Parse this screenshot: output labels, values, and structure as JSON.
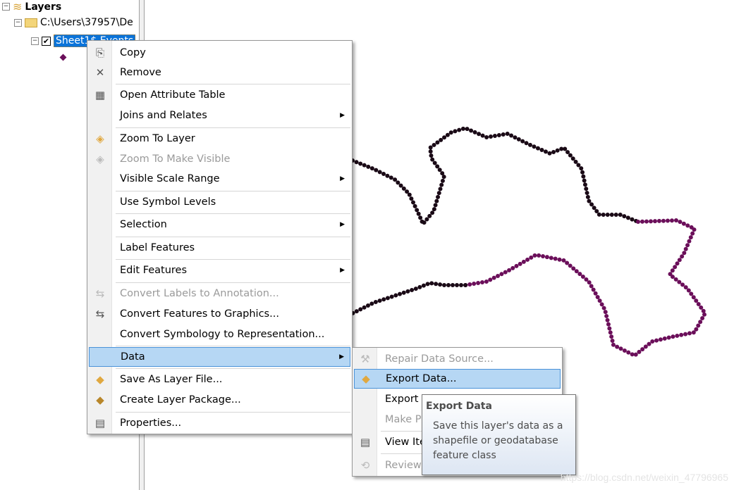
{
  "toc": {
    "root": "Layers",
    "folder": "C:\\Users\\37957\\De",
    "layer": "Sheet1$ Events",
    "layer_checked": true
  },
  "menu": {
    "items": [
      {
        "label": "Copy",
        "icon": "copy-icon"
      },
      {
        "label": "Remove",
        "icon": "remove-x-icon"
      },
      {
        "label": "Open Attribute Table",
        "icon": "table-icon"
      },
      {
        "label": "Joins and Relates",
        "submenu": true
      },
      {
        "label": "Zoom To Layer",
        "icon": "zoom-layer-icon"
      },
      {
        "label": "Zoom To Make Visible",
        "icon": "zoom-visible-icon",
        "disabled": true
      },
      {
        "label": "Visible Scale Range",
        "submenu": true
      },
      {
        "label": "Use Symbol Levels"
      },
      {
        "label": "Selection",
        "submenu": true
      },
      {
        "label": "Label Features"
      },
      {
        "label": "Edit Features",
        "submenu": true
      },
      {
        "label": "Convert Labels to Annotation...",
        "icon": "convert-labels-icon",
        "disabled": true
      },
      {
        "label": "Convert Features to Graphics...",
        "icon": "convert-graphics-icon"
      },
      {
        "label": "Convert Symbology to Representation..."
      },
      {
        "label": "Data",
        "submenu": true,
        "highlighted": true
      },
      {
        "label": "Save As Layer File...",
        "icon": "layer-file-icon"
      },
      {
        "label": "Create Layer Package...",
        "icon": "layer-package-icon"
      },
      {
        "label": "Properties...",
        "icon": "properties-icon"
      }
    ]
  },
  "submenu": {
    "items": [
      {
        "label": "Repair Data Source...",
        "icon": "repair-icon",
        "disabled": true
      },
      {
        "label": "Export Data...",
        "icon": "export-data-icon",
        "highlighted": true
      },
      {
        "label": "Export "
      },
      {
        "label": "Make P",
        "disabled": true
      },
      {
        "label": "View Ite",
        "icon": "document-icon"
      },
      {
        "label": "Review/",
        "icon": "review-icon",
        "disabled": true
      }
    ]
  },
  "tooltip": {
    "title": "Export Data",
    "body": "Save this layer's data as a shapefile or geodatabase feature class"
  },
  "watermark": "https://blog.csdn.net/weixin_47796965",
  "colors": {
    "highlight": "#b6d7f4",
    "point": "#6b0f5a"
  }
}
